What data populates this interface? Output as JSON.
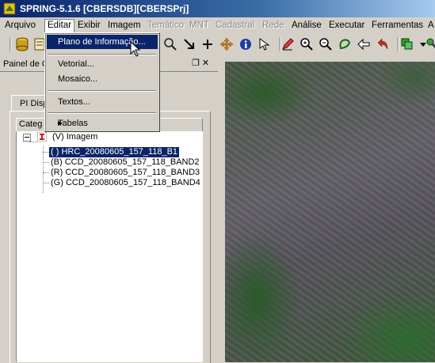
{
  "window": {
    "title": "SPRING-5.1.6 [CBERSDB][CBERSPrj]"
  },
  "menubar": {
    "items": [
      {
        "label": "Arquivo",
        "enabled": true
      },
      {
        "label": "Editar",
        "enabled": true,
        "open": true
      },
      {
        "label": "Exibir",
        "enabled": true
      },
      {
        "label": "Imagem",
        "enabled": true
      },
      {
        "label": "Temático",
        "enabled": false
      },
      {
        "label": "MNT",
        "enabled": false
      },
      {
        "label": "Cadastral",
        "enabled": false
      },
      {
        "label": "Rede",
        "enabled": false
      },
      {
        "label": "Análise",
        "enabled": true
      },
      {
        "label": "Executar",
        "enabled": true
      },
      {
        "label": "Ferramentas",
        "enabled": true
      },
      {
        "label": "A",
        "enabled": true
      }
    ]
  },
  "edit_menu": {
    "items": [
      {
        "label": "Plano de Informação...",
        "highlighted": true
      },
      {
        "label": "Vetorial..."
      },
      {
        "label": "Mosaico..."
      },
      {
        "label": "Textos..."
      },
      {
        "label": "Tabelas",
        "submenu": true
      }
    ]
  },
  "toolbar": {
    "icons": [
      "database-icon",
      "map-icon",
      "pan-icon",
      "cursor-icon",
      "add-icon",
      "move-icon",
      "info-icon",
      "select-icon",
      "pencil-icon",
      "zoom-in-icon",
      "zoom-out-icon",
      "zoom-area-icon",
      "back-icon",
      "undo-icon",
      "layers-icon",
      "dropdown-icon",
      "wrench-icon"
    ]
  },
  "panel": {
    "title": "Painel de C",
    "controls": "❐ ✕",
    "tab": "PI Disp",
    "header": "Categ",
    "tree": {
      "root": "(V) Imagem",
      "children": [
        {
          "label": "( ) HRC_20080605_157_118_B1",
          "selected": true
        },
        {
          "label": "(B) CCD_20080605_157_118_BAND2"
        },
        {
          "label": "(R) CCD_20080605_157_118_BAND3"
        },
        {
          "label": "(G) CCD_20080605_157_118_BAND4"
        }
      ]
    }
  }
}
